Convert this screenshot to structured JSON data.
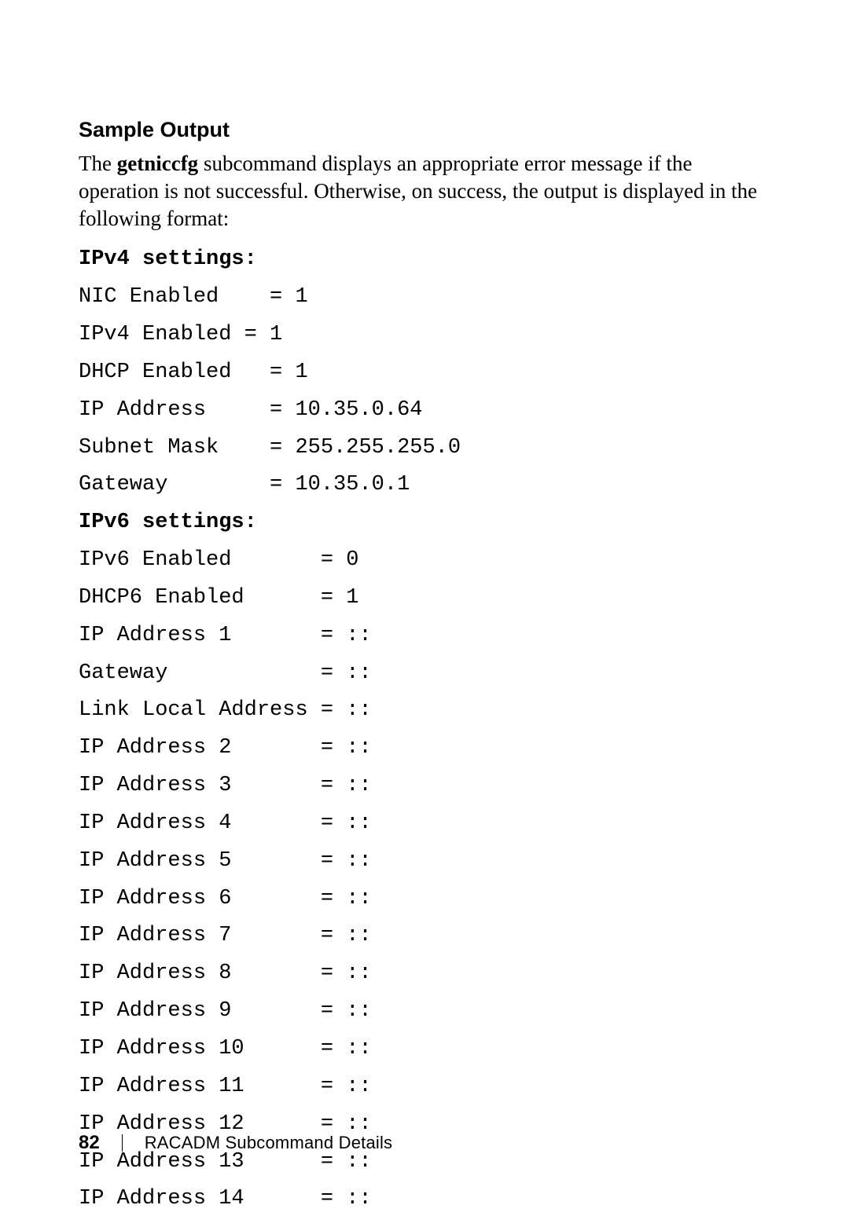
{
  "heading": "Sample Output",
  "paragraph_parts": {
    "pre": "The ",
    "cmd": "getniccfg",
    "post": " subcommand displays an appropriate error message if the operation is not successful. Otherwise, on success, the output is displayed in the following format:"
  },
  "ipv4": {
    "title": "IPv4 settings:",
    "lines": [
      "NIC Enabled    = 1",
      "IPv4 Enabled = 1",
      "DHCP Enabled   = 1",
      "IP Address     = 10.35.0.64",
      "Subnet Mask    = 255.255.255.0",
      "Gateway        = 10.35.0.1"
    ]
  },
  "ipv6": {
    "title": "IPv6 settings:",
    "lines": [
      "IPv6 Enabled       = 0",
      "DHCP6 Enabled      = 1",
      "IP Address 1       = ::",
      "Gateway            = ::",
      "Link Local Address = ::",
      "IP Address 2       = ::",
      "IP Address 3       = ::",
      "IP Address 4       = ::",
      "IP Address 5       = ::",
      "IP Address 6       = ::",
      "IP Address 7       = ::",
      "IP Address 8       = ::",
      "IP Address 9       = ::",
      "IP Address 10      = ::",
      "IP Address 11      = ::",
      "IP Address 12      = ::",
      "IP Address 13      = ::",
      "IP Address 14      = ::"
    ]
  },
  "footer": {
    "page": "82",
    "title": "RACADM Subcommand Details"
  }
}
